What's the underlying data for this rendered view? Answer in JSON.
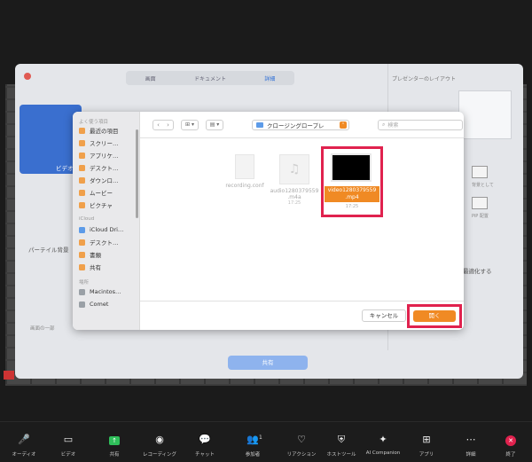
{
  "share_dialog": {
    "tabs": [
      "画面",
      "ドキュメント",
      "詳細"
    ],
    "presenter_layout_label": "プレゼンターのレイアウト",
    "video_tile_label": "ビデオ",
    "partial_label": "パーテイル背景",
    "small_label": "画面の一部",
    "optimize_label": "最適化する",
    "opt1_label": "背景として",
    "opt2_label": "PiP 配置",
    "share_button": "共有"
  },
  "picker": {
    "sidebar": {
      "favorites_header": "よく使う項目",
      "favorites": [
        {
          "label": "最近の項目",
          "icon": "clock-icon"
        },
        {
          "label": "スクリー…",
          "icon": "folder-icon"
        },
        {
          "label": "アプリケ…",
          "icon": "apps-icon"
        },
        {
          "label": "デスクト…",
          "icon": "desktop-icon"
        },
        {
          "label": "ダウンロ…",
          "icon": "download-icon"
        },
        {
          "label": "ムービー",
          "icon": "movie-icon"
        },
        {
          "label": "ピクチャ",
          "icon": "picture-icon"
        }
      ],
      "icloud_header": "iCloud",
      "icloud": [
        {
          "label": "iCloud Dri…",
          "icon": "cloud-icon"
        },
        {
          "label": "デスクト…",
          "icon": "desktop-icon"
        },
        {
          "label": "書類",
          "icon": "document-icon"
        },
        {
          "label": "共有",
          "icon": "shared-icon"
        }
      ],
      "locations_header": "場所",
      "locations": [
        {
          "label": "Macintos…",
          "icon": "disk-icon"
        },
        {
          "label": "Comet",
          "icon": "disk-icon"
        }
      ]
    },
    "toolbar": {
      "back": "‹",
      "forward": "›",
      "view_grid": "⊞ ▾",
      "view_list": "▤ ▾",
      "path": "クロージングロープレ",
      "search_placeholder": "検索"
    },
    "files": [
      {
        "name": "recording.conf",
        "date": ""
      },
      {
        "name": "audio1280379559 .m4a",
        "date": "17:25"
      }
    ],
    "selected_file": {
      "name": "video1280379559 .mp4",
      "date": "17:25"
    },
    "cancel_label": "キャンセル",
    "open_label": "開く"
  },
  "zoom_toolbar": [
    {
      "label": "オーディオ",
      "icon": "mic-off-icon"
    },
    {
      "label": "ビデオ",
      "icon": "video-icon"
    },
    {
      "label": "共有",
      "icon": "share-screen-icon"
    },
    {
      "label": "レコーディング",
      "icon": "record-icon"
    },
    {
      "label": "チャット",
      "icon": "chat-icon"
    },
    {
      "label": "参加者",
      "icon": "participants-icon",
      "count": "1"
    },
    {
      "label": "リアクション",
      "icon": "heart-icon"
    },
    {
      "label": "ホストツール",
      "icon": "shield-icon"
    },
    {
      "label": "AI Companion",
      "icon": "sparkle-icon"
    },
    {
      "label": "アプリ",
      "icon": "apps-icon"
    },
    {
      "label": "詳細",
      "icon": "more-icon"
    },
    {
      "label": "終了",
      "icon": "end-icon"
    }
  ],
  "colors": {
    "accent_orange": "#f08a24",
    "highlight_red": "#e0224e",
    "zoom_blue": "#3a6fcf"
  }
}
